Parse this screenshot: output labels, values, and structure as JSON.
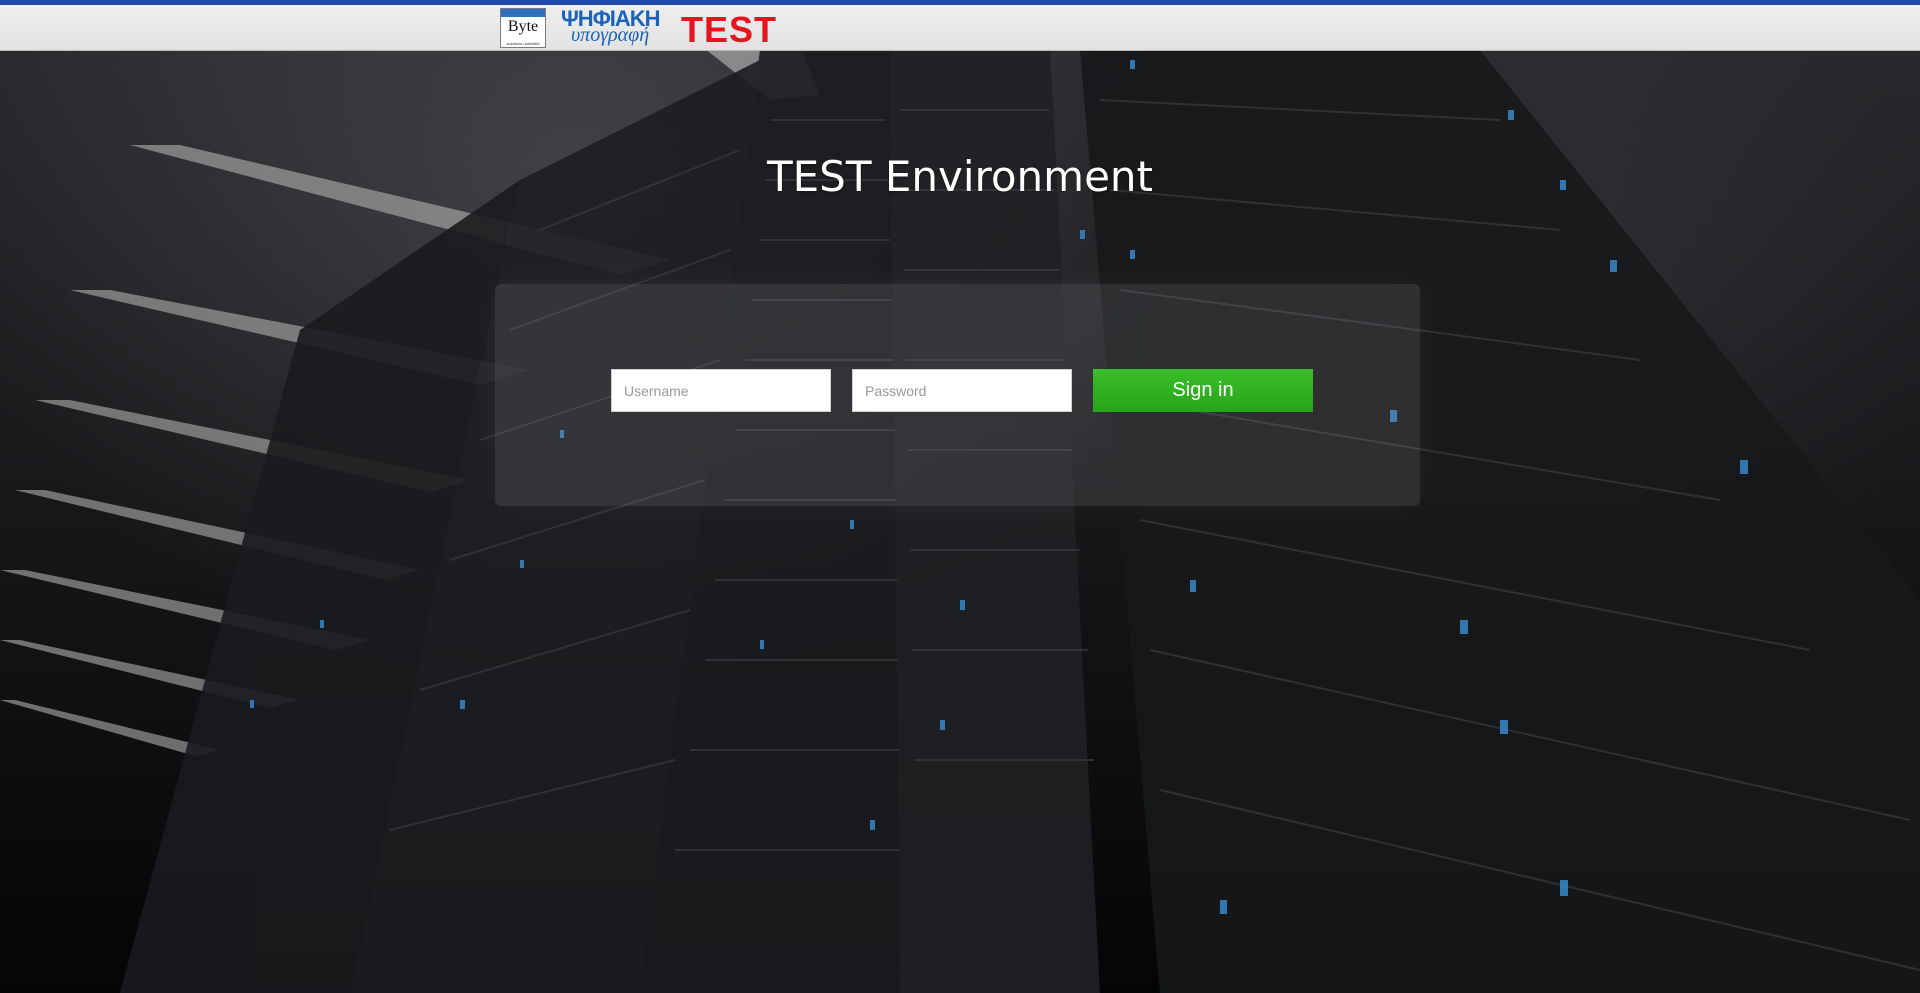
{
  "header": {
    "logo_byte_word": "Byte",
    "logo_byte_tagline": "solutions unlimited",
    "logo_greek_line1": "ΨΗΦΙΑΚΗ",
    "logo_greek_line2": "υπογραφή",
    "logo_env_label": "TEST"
  },
  "main": {
    "title": "TEST Environment"
  },
  "login": {
    "username_placeholder": "Username",
    "username_value": "",
    "password_placeholder": "Password",
    "password_value": "",
    "signin_label": "Sign in"
  },
  "colors": {
    "top_accent": "#1f4aa8",
    "signin_button": "#2eae1f",
    "env_label": "#e5141e",
    "brand_blue": "#1a63b8"
  }
}
